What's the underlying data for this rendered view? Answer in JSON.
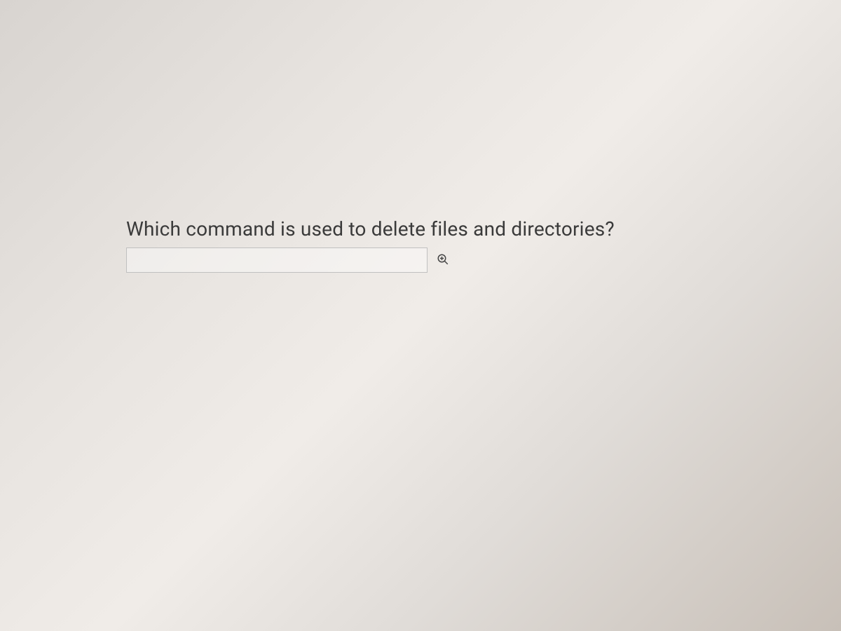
{
  "question": {
    "text": "Which command is used to delete files and directories?",
    "answer_value": "",
    "answer_placeholder": ""
  },
  "icons": {
    "zoom": "zoom-in-icon"
  }
}
